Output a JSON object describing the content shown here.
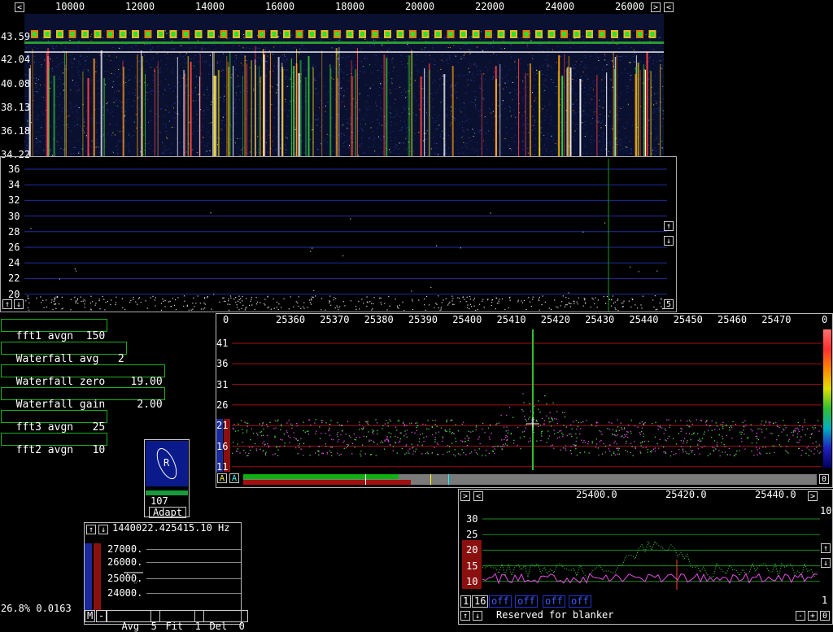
{
  "colors": {
    "waterfall_bg": "#0a1030",
    "grid_blue": "#1b2fa0",
    "grid_red": "#a01010",
    "grid_green": "#1c8c1c",
    "param_border": "#1bb01b"
  },
  "top_panel": {
    "freq_ticks": [
      "10000",
      "12000",
      "14000",
      "16000",
      "18000",
      "20000",
      "22000",
      "24000",
      "26000"
    ],
    "time_labels": [
      "43.59",
      "42.04",
      "40.08",
      "38.13",
      "36.18",
      "34.22"
    ],
    "left_arrow": "<",
    "right_arrow": ">"
  },
  "spectrum_panel": {
    "y_ticks": [
      "36",
      "34",
      "32",
      "30",
      "28",
      "26",
      "24",
      "22",
      "20"
    ],
    "up_arrow": "↑",
    "down_arrow": "↓",
    "corner_value": "5"
  },
  "params": [
    {
      "label": "fft1 avgn",
      "value": "150"
    },
    {
      "label": "Waterfall avg",
      "value": "2"
    },
    {
      "label": "Waterfall zero",
      "value": "19.00"
    },
    {
      "label": "Waterfall gain",
      "value": "2.00"
    },
    {
      "label": "fft3 avgn",
      "value": "25"
    },
    {
      "label": "fft2 avgn",
      "value": "10"
    }
  ],
  "adapt_widget": {
    "letter": "R",
    "value": "107",
    "button": "Adapt"
  },
  "freq_control": {
    "readout": "1440022.425415.10 Hz",
    "y_ticks": [
      "27000.",
      "26000.",
      "25000.",
      "24000."
    ],
    "buttons": {
      "m": "M",
      "minus": "-",
      "avg_label": "Avg",
      "avg_value": "5",
      "fit_label": "Fit",
      "fit_value": "1",
      "del_label": "Del",
      "del_value": "0"
    }
  },
  "status_text": "26.8% 0.0163",
  "baseband_panel": {
    "left_value": "0",
    "right_value": "0",
    "x_ticks": [
      "25360",
      "25370",
      "25380",
      "25390",
      "25400",
      "25410",
      "25420",
      "25430",
      "25440",
      "25450",
      "25460",
      "25470"
    ],
    "y_ticks": [
      "41",
      "36",
      "31",
      "26",
      "21",
      "16",
      "11"
    ],
    "a_buttons": [
      "A",
      "A"
    ],
    "corner_value": "0"
  },
  "hires_panel": {
    "x_ticks": [
      "25400.0",
      "25420.0",
      "25440.0"
    ],
    "y_ticks": [
      "30",
      "25",
      "20",
      "15",
      "10"
    ],
    "right_top": "10",
    "right_bottom": "1",
    "box1": "1",
    "box2": "16",
    "off_labels": [
      "off",
      "off",
      "off",
      "off"
    ],
    "blanker_text": "Reserved for blanker",
    "minus": "-",
    "plus": "+",
    "zero": "0"
  }
}
